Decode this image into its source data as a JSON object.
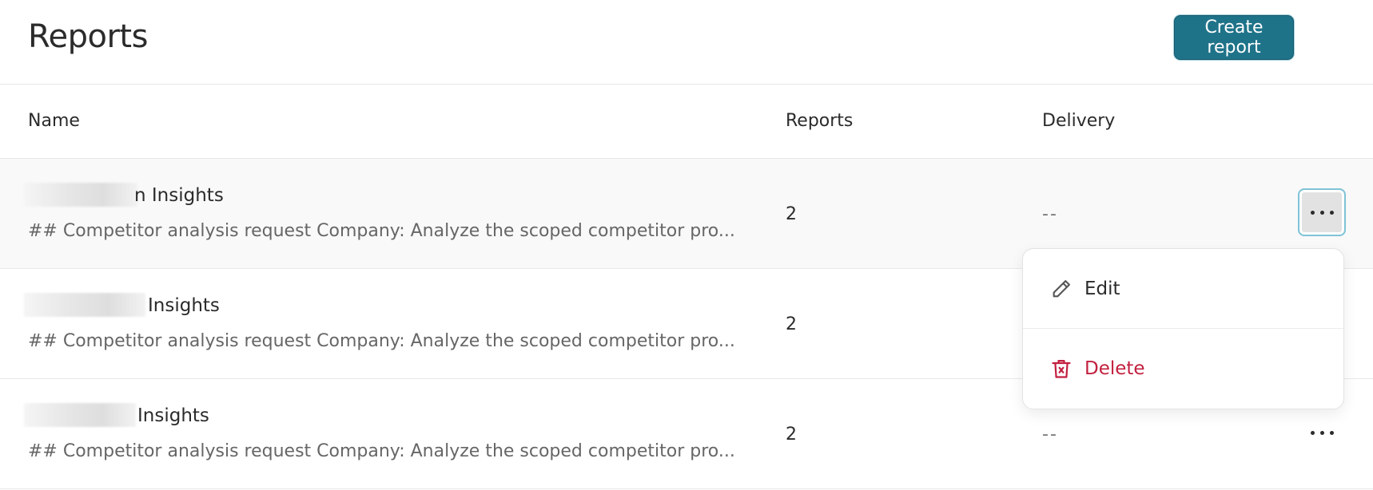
{
  "header": {
    "title": "Reports",
    "create_button_label": "Create report"
  },
  "table": {
    "columns": [
      "Name",
      "Reports",
      "Delivery"
    ],
    "rows": [
      {
        "title_visible": "n Insights",
        "description": "## Competitor analysis request Company: Analyze the scoped competitor pro...",
        "reports": "2",
        "delivery": "--"
      },
      {
        "title_visible": "Insights",
        "description": "## Competitor analysis request Company: Analyze the scoped competitor pro...",
        "reports": "2",
        "delivery": "--"
      },
      {
        "title_visible": "Insights",
        "description": "## Competitor analysis request Company: Analyze the scoped competitor pro...",
        "reports": "2",
        "delivery": "--"
      }
    ]
  },
  "menu": {
    "items": [
      {
        "label": "Edit",
        "icon": "pencil-icon"
      },
      {
        "label": "Delete",
        "icon": "trash-icon"
      }
    ]
  },
  "colors": {
    "accent": "#1f7389",
    "danger": "#c2203f",
    "text": "#2b2b2b",
    "muted": "#666666"
  }
}
